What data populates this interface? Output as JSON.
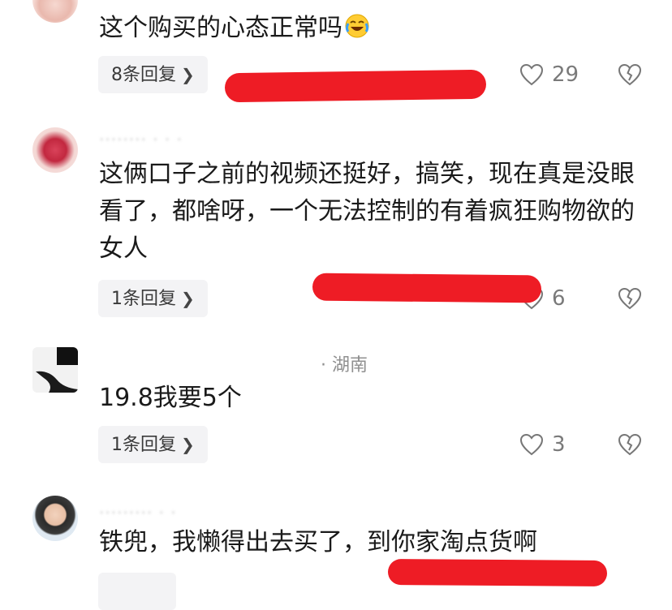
{
  "comments": [
    {
      "text": "这个购买的心态正常吗",
      "emoji": "laughing-crying-emoji",
      "reply_label": "8条回复",
      "likes": "29"
    },
    {
      "meta_blur": "········ · · ·",
      "text": "这俩口子之前的视频还挺好，搞笑，现在真是没眼看了，都啥呀，一个无法控制的有着疯狂购物欲的女人",
      "reply_label": "1条回复",
      "likes": "6"
    },
    {
      "meta_location": "· 湖南",
      "text": "19.8我要5个",
      "reply_label": "1条回复",
      "likes": "3"
    },
    {
      "meta_blur": "········· · ·",
      "text": "铁兜，我懒得出去买了，到你家淘点货啊"
    }
  ],
  "icons": {
    "like": "heart-outline-icon",
    "dislike": "broken-heart-icon",
    "chevron": "chevron-right-icon"
  },
  "colors": {
    "redaction": "#ee1c25",
    "reply_bg": "#f3f3f5",
    "text": "#1a1a1a",
    "muted": "#8f8f8f"
  }
}
